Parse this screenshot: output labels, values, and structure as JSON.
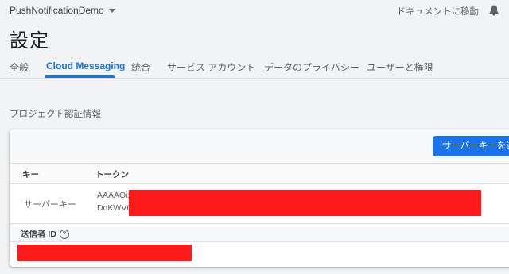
{
  "header": {
    "project_name": "PushNotificationDemo",
    "docs_link": "ドキュメントに移動"
  },
  "page": {
    "title": "設定"
  },
  "tabs": [
    {
      "label": "全般",
      "active": false
    },
    {
      "label": "Cloud Messaging",
      "active": true
    },
    {
      "label": "統合",
      "active": false
    },
    {
      "label": "サービス アカウント",
      "active": false
    },
    {
      "label": "データのプライバシー",
      "active": false
    },
    {
      "label": "ユーザーと権限",
      "active": false
    }
  ],
  "credentials": {
    "section_title": "プロジェクト認証情報",
    "add_button_label": "サーバーキーを追",
    "columns": {
      "key": "キー",
      "token": "トークン"
    },
    "server_key": {
      "type_label": "サーバーキー",
      "token_line1": "AAAAOix",
      "token_line2": "DdKWV6l"
    },
    "sender_id_label": "送信者 ID"
  },
  "colors": {
    "accent": "#1a73e8",
    "redaction": "#ff1a1a"
  }
}
